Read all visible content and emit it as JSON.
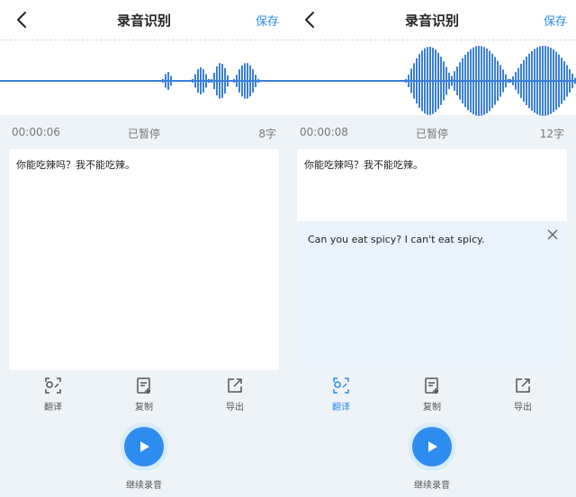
{
  "header": {
    "title": "录音识别",
    "save_label": "保存"
  },
  "left": {
    "time": "00:00:06",
    "status": "已暂停",
    "count": "8字",
    "text": "你能吃辣吗？我不能吃辣。"
  },
  "right": {
    "time": "00:00:08",
    "status": "已暂停",
    "count": "12字",
    "text": "你能吃辣吗？我不能吃辣。",
    "translation": "Can you eat spicy? I can't eat spicy."
  },
  "actions": {
    "translate": "翻译",
    "copy": "复制",
    "export": "导出"
  },
  "record_label": "继续录音",
  "colors": {
    "accent": "#2d8cf0",
    "wave": "#3a7fd8"
  }
}
